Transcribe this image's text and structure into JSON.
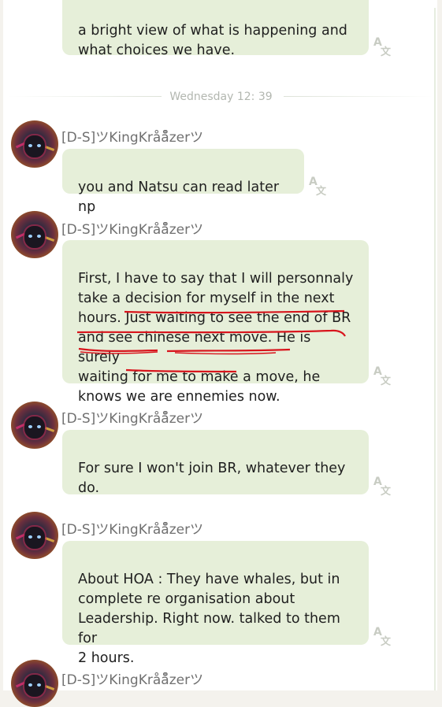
{
  "date_separator": "Wednesday 12: 39",
  "sender_name": "[D-S]ツKingKråå̊zerツ",
  "messages": [
    {
      "text": "a bright view of what is happening and\nwhat choices we have."
    },
    {
      "text": "you and Natsu can read later np"
    },
    {
      "text": "First, I have to say that I will personnaly\ntake a decision for myself in the next\nhours. Just waiting to see the end of BR\nand see chinese next move. He is surely\nwaiting for me to make a move, he\nknows we are ennemies now."
    },
    {
      "text": "For sure I won't join BR, whatever they\ndo."
    },
    {
      "text": "About HOA : They have whales, but in\ncomplete re organisation about\nLeadership. Right now. talked to them for\n2 hours."
    }
  ],
  "colors": {
    "bubble": "#e6efd9",
    "annotation_red": "#d8141c",
    "name_gray": "#707070"
  },
  "icons": [
    "translate-icon",
    "avatar"
  ]
}
